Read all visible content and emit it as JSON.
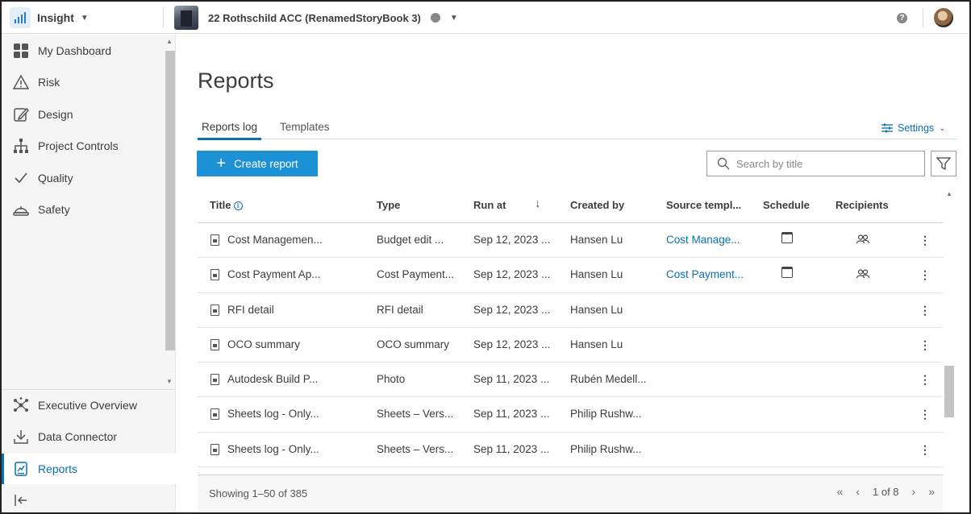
{
  "header": {
    "app_name": "Insight",
    "project_name": "22 Rothschild ACC (RenamedStoryBook 3)",
    "help": "?"
  },
  "sidebar": {
    "items": [
      {
        "label": "My Dashboard",
        "icon": "dashboard-grid-icon"
      },
      {
        "label": "Risk",
        "icon": "warning-triangle-icon"
      },
      {
        "label": "Design",
        "icon": "pencil-edit-icon"
      },
      {
        "label": "Project Controls",
        "icon": "hierarchy-icon"
      },
      {
        "label": "Quality",
        "icon": "checkmark-icon"
      },
      {
        "label": "Safety",
        "icon": "hard-hat-icon"
      }
    ],
    "bottom_items": [
      {
        "label": "Executive Overview",
        "icon": "network-icon"
      },
      {
        "label": "Data Connector",
        "icon": "download-icon"
      },
      {
        "label": "Reports",
        "icon": "report-icon",
        "active": true
      }
    ]
  },
  "page": {
    "title": "Reports",
    "tabs": [
      {
        "label": "Reports log",
        "active": true
      },
      {
        "label": "Templates",
        "active": false
      }
    ],
    "settings_label": "Settings",
    "create_label": "Create report",
    "search_placeholder": "Search by title"
  },
  "table": {
    "columns": [
      "Title",
      "Type",
      "Run at",
      "Created by",
      "Source templ...",
      "Schedule",
      "Recipients"
    ],
    "rows": [
      {
        "title": "Cost Managemen...",
        "type": "Budget edit ...",
        "run_at": "Sep 12, 2023 ...",
        "created_by": "Hansen Lu",
        "source": "Cost Manage...",
        "schedule": true,
        "recipients": true
      },
      {
        "title": "Cost Payment Ap...",
        "type": "Cost Payment...",
        "run_at": "Sep 12, 2023 ...",
        "created_by": "Hansen Lu",
        "source": "Cost Payment...",
        "schedule": true,
        "recipients": true
      },
      {
        "title": "RFI detail",
        "type": "RFI detail",
        "run_at": "Sep 12, 2023 ...",
        "created_by": "Hansen Lu",
        "source": "",
        "schedule": false,
        "recipients": false
      },
      {
        "title": "OCO summary",
        "type": "OCO summary",
        "run_at": "Sep 12, 2023 ...",
        "created_by": "Hansen Lu",
        "source": "",
        "schedule": false,
        "recipients": false
      },
      {
        "title": "Autodesk Build P...",
        "type": "Photo",
        "run_at": "Sep 11, 2023 ...",
        "created_by": "Rubén Medell...",
        "source": "",
        "schedule": false,
        "recipients": false
      },
      {
        "title": "Sheets log - Only...",
        "type": "Sheets – Vers...",
        "run_at": "Sep 11, 2023 ...",
        "created_by": "Philip Rushw...",
        "source": "",
        "schedule": false,
        "recipients": false
      },
      {
        "title": "Sheets log - Only...",
        "type": "Sheets – Vers...",
        "run_at": "Sep 11, 2023 ...",
        "created_by": "Philip Rushw...",
        "source": "",
        "schedule": false,
        "recipients": false
      }
    ]
  },
  "footer": {
    "showing": "Showing 1–50 of 385",
    "page_indicator": "1 of 8"
  },
  "colors": {
    "accent": "#0a6fb3",
    "button": "#1d91d6"
  }
}
